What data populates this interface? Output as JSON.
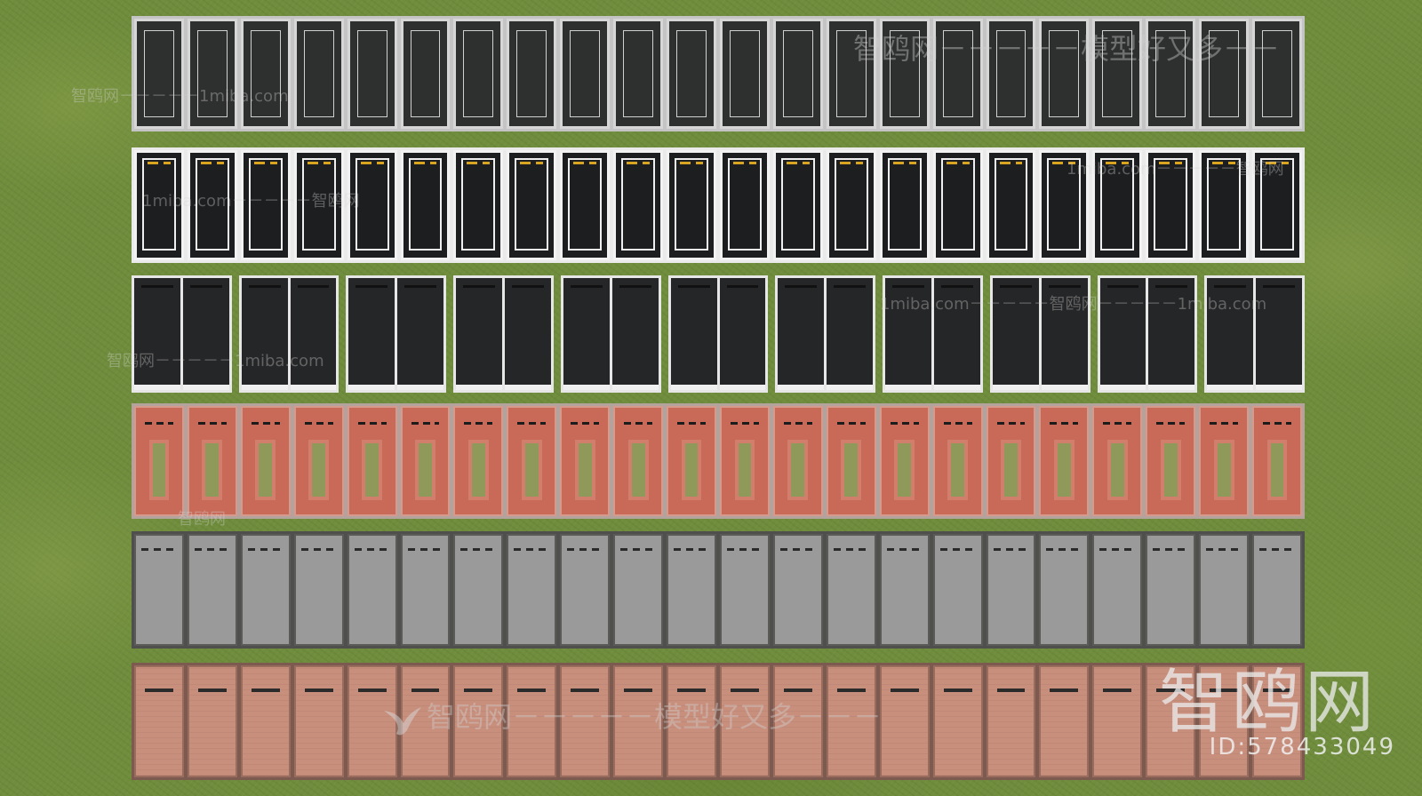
{
  "image": {
    "scene": "top-down slab texture catalog on grass",
    "rows": [
      {
        "id": "r1",
        "count": 22
      },
      {
        "id": "r2",
        "count": 22
      },
      {
        "id": "r3",
        "pairs": 11
      },
      {
        "id": "r4",
        "count": 22
      },
      {
        "id": "r5",
        "count": 22
      },
      {
        "id": "r6",
        "count": 22
      }
    ],
    "colors": {
      "grass": "#6f8d3c",
      "dark_slab": "#2e2f2f",
      "asphalt": "#1d1e1f",
      "yellow_mark": "#d9a520",
      "red_brick": "#c96a58",
      "gray_concrete": "#9a9a9a",
      "salmon_brick": "#c98f7d"
    }
  },
  "watermarks": {
    "top_line": "智鸥网－－－－－模型好又多－－",
    "top_left": "智鸥网－－－－－1miba.com",
    "row2_left": "1miba.com－－－－－智鸥网",
    "row2_right": "1miba.com－－－－－智鸥网",
    "row3_mid": "1miba.com－－－－－智鸥网－－－－－1miba.com",
    "row3_left": "智鸥网－－－－－1miba.com",
    "row4_small": "智鸥网",
    "bottom_line": "智鸥网－－－－－模型好又多－－－",
    "logo": "智鸥网",
    "id": "ID:578433049"
  }
}
